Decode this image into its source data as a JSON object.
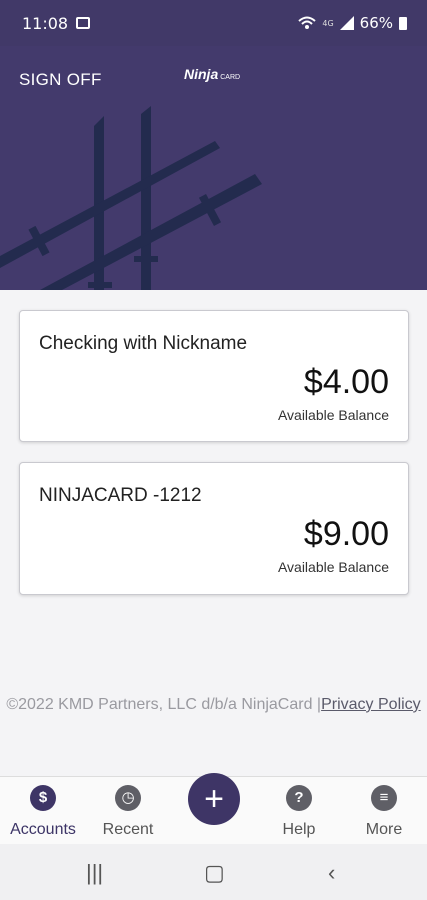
{
  "status_bar": {
    "time": "11:08",
    "network": "4G",
    "battery": "66%",
    "icons": [
      "gallery-icon",
      "wifi-calling-icon",
      "signal-icon",
      "battery-icon"
    ]
  },
  "header": {
    "sign_off_label": "SIGN OFF",
    "logo_text": "Ninja",
    "logo_subtext": "CARD",
    "background_color": "#433a6c"
  },
  "accounts": [
    {
      "name": "Checking with Nickname",
      "balance": "$4.00",
      "balance_label": "Available Balance"
    },
    {
      "name": "NINJACARD -1212",
      "balance": "$9.00",
      "balance_label": "Available Balance"
    }
  ],
  "footer": {
    "copyright": "©2022 KMD Partners, LLC d/b/a NinjaCard |",
    "privacy_link": "Privacy Policy"
  },
  "tab_bar": {
    "tabs": [
      {
        "label": "Accounts",
        "icon": "accounts-icon",
        "active": true
      },
      {
        "label": "Recent",
        "icon": "clock-icon",
        "active": false
      },
      {
        "label": "Help",
        "icon": "help-icon",
        "active": false
      },
      {
        "label": "More",
        "icon": "menu-icon",
        "active": false
      }
    ],
    "fab_icon": "plus-icon",
    "accent_color": "#3e3566"
  },
  "nav_bar": {
    "icons": [
      "recent-apps-icon",
      "home-icon",
      "back-icon"
    ]
  }
}
